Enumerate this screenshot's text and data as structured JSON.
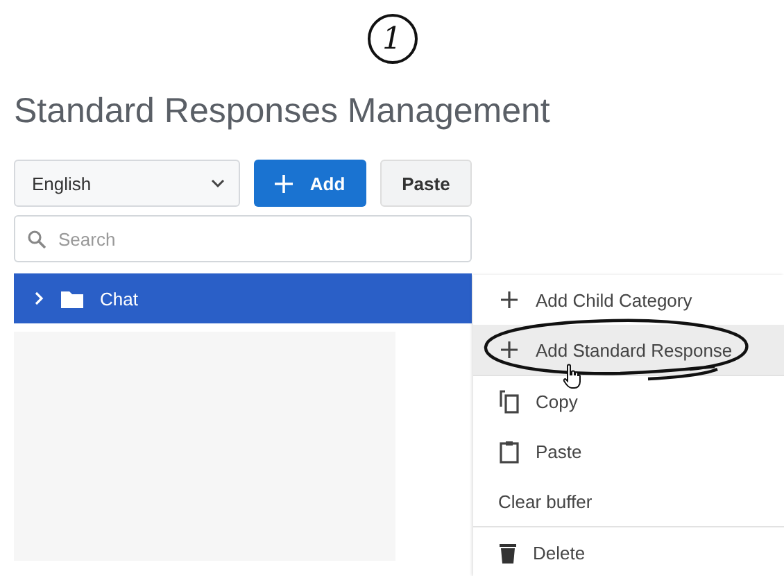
{
  "step_marker": "1",
  "title": "Standard Responses Management",
  "toolbar": {
    "language": {
      "value": "English"
    },
    "add_button": "Add",
    "paste_button": "Paste"
  },
  "search": {
    "placeholder": "Search"
  },
  "tree": [
    {
      "label": "Chat",
      "expanded": false,
      "selected": true
    }
  ],
  "context_menu": [
    [
      {
        "label": "Add Child Category",
        "kind": "plus",
        "highlighted": false
      },
      {
        "label": "Add Standard Response",
        "kind": "plus",
        "highlighted": true
      }
    ],
    [
      {
        "label": "Copy",
        "kind": "copy",
        "highlighted": false
      },
      {
        "label": "Paste",
        "kind": "paste",
        "highlighted": false
      },
      {
        "label": "Clear buffer",
        "kind": "text",
        "highlighted": false
      }
    ],
    [
      {
        "label": "Delete",
        "kind": "delete",
        "highlighted": false
      }
    ]
  ]
}
